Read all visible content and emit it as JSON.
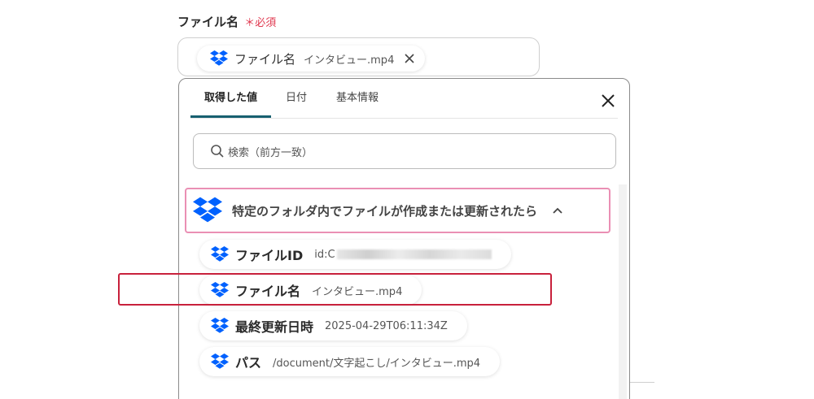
{
  "field": {
    "label": "ファイル名",
    "required_mark": "＊",
    "required_text": "必須",
    "chip": {
      "label": "ファイル名",
      "value": "インタビュー.mp4",
      "icon": "dropbox-icon"
    }
  },
  "panel": {
    "tabs": [
      {
        "label": "取得した値",
        "active": true
      },
      {
        "label": "日付",
        "active": false
      },
      {
        "label": "基本情報",
        "active": false
      }
    ],
    "search_placeholder": "検索（前方一致）",
    "section": {
      "title": "特定のフォルダ内でファイルが作成または更新されたら",
      "expanded": true
    },
    "items": [
      {
        "label": "ファイルID",
        "value": "id:C"
      },
      {
        "label": "ファイル名",
        "value": "インタビュー.mp4"
      },
      {
        "label": "最終更新日時",
        "value": "2025-04-29T06:11:34Z"
      },
      {
        "label": "パス",
        "value": "/document/文字起こし/インタビュー.mp4"
      }
    ]
  },
  "colors": {
    "accent": "#176070",
    "required": "#e0384f",
    "dropbox": "#0061fe",
    "section_border": "#ea8fb4",
    "highlight": "#c8213c"
  }
}
